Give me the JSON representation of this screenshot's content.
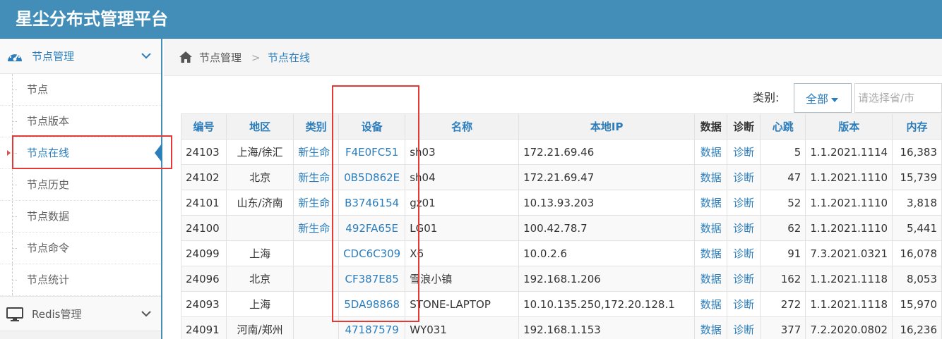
{
  "app": {
    "title": "星尘分布式管理平台"
  },
  "sidebar": {
    "group1": {
      "label": "节点管理"
    },
    "items": [
      {
        "label": "节点"
      },
      {
        "label": "节点版本"
      },
      {
        "label": "节点在线"
      },
      {
        "label": "节点历史"
      },
      {
        "label": "节点数据"
      },
      {
        "label": "节点命令"
      },
      {
        "label": "节点统计"
      }
    ],
    "group2": {
      "label": "Redis管理"
    }
  },
  "breadcrumb": {
    "root": "节点管理",
    "separator": ">",
    "current": "节点在线"
  },
  "filter": {
    "label": "类别:",
    "category": "全部",
    "region_placeholder": "请选择省/市"
  },
  "table": {
    "headers": {
      "id": "编号",
      "region": "地区",
      "category": "类别",
      "device": "设备",
      "name": "名称",
      "ip": "本地IP",
      "data": "数据",
      "diag": "诊断",
      "heartbeat": "心跳",
      "version": "版本",
      "memory": "内存"
    },
    "rows": [
      {
        "id": "24103",
        "region": "上海/徐汇",
        "category": "新生命",
        "device": "F4E0FC51",
        "name": "sh03",
        "ip": "172.21.69.46",
        "data": "数据",
        "diag": "诊断",
        "heartbeat": "5",
        "version": "1.1.2021.1114",
        "memory": "16,383"
      },
      {
        "id": "24102",
        "region": "北京",
        "category": "新生命",
        "device": "0B5D862E",
        "name": "sh04",
        "ip": "172.21.69.47",
        "data": "数据",
        "diag": "诊断",
        "heartbeat": "47",
        "version": "1.1.2021.1110",
        "memory": "15,739"
      },
      {
        "id": "24101",
        "region": "山东/济南",
        "category": "新生命",
        "device": "B3746154",
        "name": "gz01",
        "ip": "10.13.93.203",
        "data": "数据",
        "diag": "诊断",
        "heartbeat": "52",
        "version": "1.1.2021.1110",
        "memory": "3,818"
      },
      {
        "id": "24100",
        "region": "",
        "category": "新生命",
        "device": "492FA65E",
        "name": "LG01",
        "ip": "100.42.78.7",
        "data": "数据",
        "diag": "诊断",
        "heartbeat": "62",
        "version": "1.1.2021.1110",
        "memory": "5,441"
      },
      {
        "id": "24099",
        "region": "上海",
        "category": "",
        "device": "CDC6C309",
        "name": "X6",
        "ip": "10.0.2.6",
        "data": "数据",
        "diag": "诊断",
        "heartbeat": "91",
        "version": "7.3.2021.0321",
        "memory": "16,078"
      },
      {
        "id": "24096",
        "region": "北京",
        "category": "",
        "device": "CF387E85",
        "name": "雪浪小镇",
        "ip": "192.168.1.206",
        "data": "数据",
        "diag": "诊断",
        "heartbeat": "162",
        "version": "1.1.2021.1118",
        "memory": "8,053"
      },
      {
        "id": "24093",
        "region": "上海",
        "category": "",
        "device": "5DA98868",
        "name": "STONE-LAPTOP",
        "ip": "10.10.135.250,172.20.128.1",
        "data": "数据",
        "diag": "诊断",
        "heartbeat": "272",
        "version": "1.1.2021.1118",
        "memory": "15,970"
      },
      {
        "id": "24091",
        "region": "河南/郑州",
        "category": "",
        "device": "47187579",
        "name": "WY031",
        "ip": "192.168.1.153",
        "data": "数据",
        "diag": "诊断",
        "heartbeat": "377",
        "version": "7.2.2020.0802",
        "memory": "16,236"
      }
    ]
  },
  "colors": {
    "brand": "#438eb9",
    "link": "#2b7dbc",
    "highlight": "#e53935"
  },
  "icons": {
    "group1": "tachometer-icon",
    "group2": "desktop-icon",
    "home": "home-icon",
    "chevron": "chevron-down-icon"
  }
}
